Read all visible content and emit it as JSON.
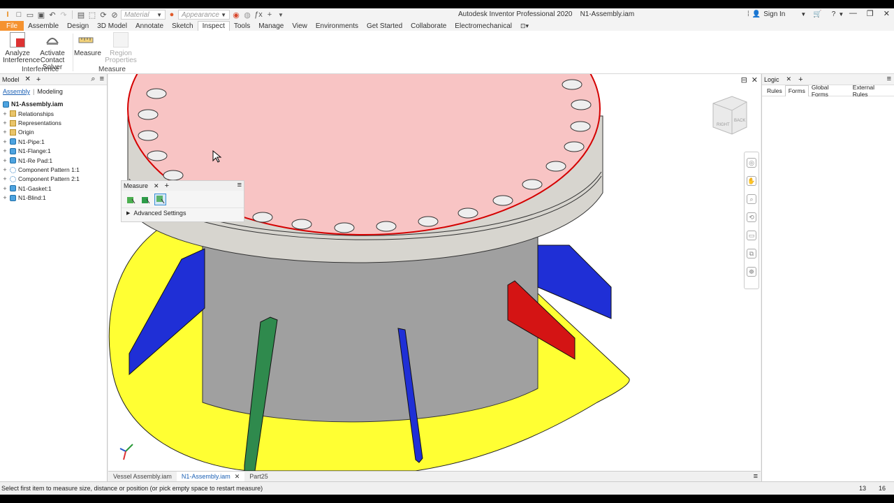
{
  "app": {
    "title": "Autodesk Inventor Professional 2020",
    "document": "N1-Assembly.iam",
    "sign_in": "Sign In"
  },
  "qat": {
    "material_placeholder": "Material",
    "appearance_placeholder": "Appearance"
  },
  "ribbon": {
    "tabs": [
      {
        "label": "File"
      },
      {
        "label": "Assemble"
      },
      {
        "label": "Design"
      },
      {
        "label": "3D Model"
      },
      {
        "label": "Annotate"
      },
      {
        "label": "Sketch"
      },
      {
        "label": "Inspect"
      },
      {
        "label": "Tools"
      },
      {
        "label": "Manage"
      },
      {
        "label": "View"
      },
      {
        "label": "Environments"
      },
      {
        "label": "Get Started"
      },
      {
        "label": "Collaborate"
      },
      {
        "label": "Electromechanical"
      }
    ],
    "buttons": {
      "analyze_1": "Analyze",
      "analyze_2": "Interference",
      "activate_1": "Activate",
      "activate_2": "Contact Solver",
      "measure": "Measure",
      "region": "Region Properties"
    },
    "panels": {
      "interference": "Interference",
      "measure": "Measure"
    }
  },
  "browser": {
    "title": "Model",
    "assembly_tab": "Assembly",
    "modeling_tab": "Modeling",
    "root": "N1-Assembly.iam",
    "items": [
      {
        "label": "Relationships",
        "icon": "folder-icon"
      },
      {
        "label": "Representations",
        "icon": "folder-icon"
      },
      {
        "label": "Origin",
        "icon": "folder-icon"
      },
      {
        "label": "N1-Pipe:1",
        "icon": "part-icon"
      },
      {
        "label": "N1-Flange:1",
        "icon": "part-icon"
      },
      {
        "label": "N1-Re Pad:1",
        "icon": "part-icon"
      },
      {
        "label": "Component Pattern 1:1",
        "icon": "pattern-icon"
      },
      {
        "label": "Component Pattern 2:1",
        "icon": "pattern-icon"
      },
      {
        "label": "N1-Gasket:1",
        "icon": "part-icon"
      },
      {
        "label": "N1-Blind:1",
        "icon": "part-icon"
      }
    ]
  },
  "measure_dialog": {
    "title": "Measure",
    "advanced": "Advanced Settings"
  },
  "doc_tabs": [
    {
      "label": "Vessel Assembly.iam"
    },
    {
      "label": "N1-Assembly.iam"
    },
    {
      "label": "Part25"
    }
  ],
  "logic": {
    "title": "Logic",
    "tabs": [
      {
        "label": "Rules"
      },
      {
        "label": "Forms"
      },
      {
        "label": "Global Forms"
      },
      {
        "label": "External Rules"
      }
    ]
  },
  "viewcube": {
    "face_right": "RIGHT",
    "face_back": "BACK"
  },
  "status": {
    "message": "Select first item to measure size, distance or position (or pick empty space to restart measure)",
    "count1": "13",
    "count2": "16"
  },
  "colors": {
    "accent": "#f5922f",
    "blind_face": "#f8c4c4",
    "edge_red": "#d40000",
    "pad_yellow": "#ffff33",
    "gusset_blue": "#1f2fd6",
    "gusset_red": "#d41414",
    "gusset_green": "#2f8a4d"
  }
}
